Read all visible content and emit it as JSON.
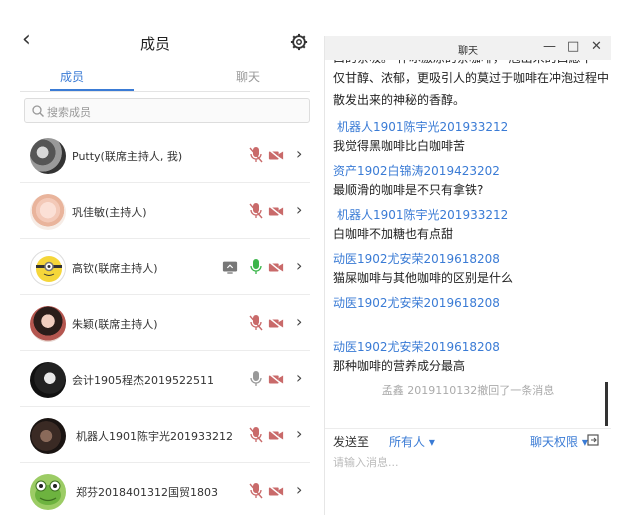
{
  "header": {
    "title": "成员"
  },
  "tabs": {
    "members": "成员",
    "chat": "聊天"
  },
  "search": {
    "placeholder": "搜索成员"
  },
  "members": [
    {
      "name": "Putty(联席主持人, 我)",
      "avatar": "photo-bw"
    },
    {
      "name": "巩佳敏(主持人)",
      "avatar": "cartoon-girl"
    },
    {
      "name": "高钦(联席主持人)",
      "avatar": "minion"
    },
    {
      "name": "朱颖(联席主持人)",
      "avatar": "photo-girl"
    },
    {
      "name": "会计1905程杰2019522511",
      "avatar": "photo-dark"
    },
    {
      "name": "机器人1901陈宇光201933212",
      "avatar": "photo-face"
    },
    {
      "name": "郑芬2018401312国贸1803",
      "avatar": "frog"
    }
  ],
  "chat": {
    "window_title": "聊天",
    "window_buttons": {
      "minimize": "—",
      "maximize": "□",
      "close": "✕"
    },
    "lines": {
      "cut_top": "曰的亲吸。  怀冰激凉的亲咖啡，   庖出米的口愿不",
      "para1": "仅甘醇、浓郁，更吸引人的莫过于咖啡在冲泡过程中",
      "para2": "散发出来的神秘的香醇。",
      "s1": "机器人1901陈宇光201933212",
      "m1": "我觉得黑咖啡比白咖啡苦",
      "s2": "资产1902白锦涛2019423202",
      "m2": "最顺滑的咖啡是不只有拿铁?",
      "s3": "机器人1901陈宇光201933212",
      "m3": "白咖啡不加糖也有点甜",
      "s4": "动医1902尤安荣2019618208",
      "m4": "猫屎咖啡与其他咖啡的区别是什么",
      "s5": "动医1902尤安荣2019618208",
      "s6": "动医1902尤安荣2019618208",
      "m6": "那种咖啡的营养成分最高",
      "recall": "孟鑫 2019110132撤回了一条消息"
    },
    "send_to": "发送至",
    "send_target": "所有人",
    "permission": "聊天权限",
    "input_placeholder": "请输入消息..."
  },
  "colors": {
    "accent": "#3a7bd5",
    "muted_red": "#c96a6a",
    "mic_green": "#3bb54a"
  }
}
